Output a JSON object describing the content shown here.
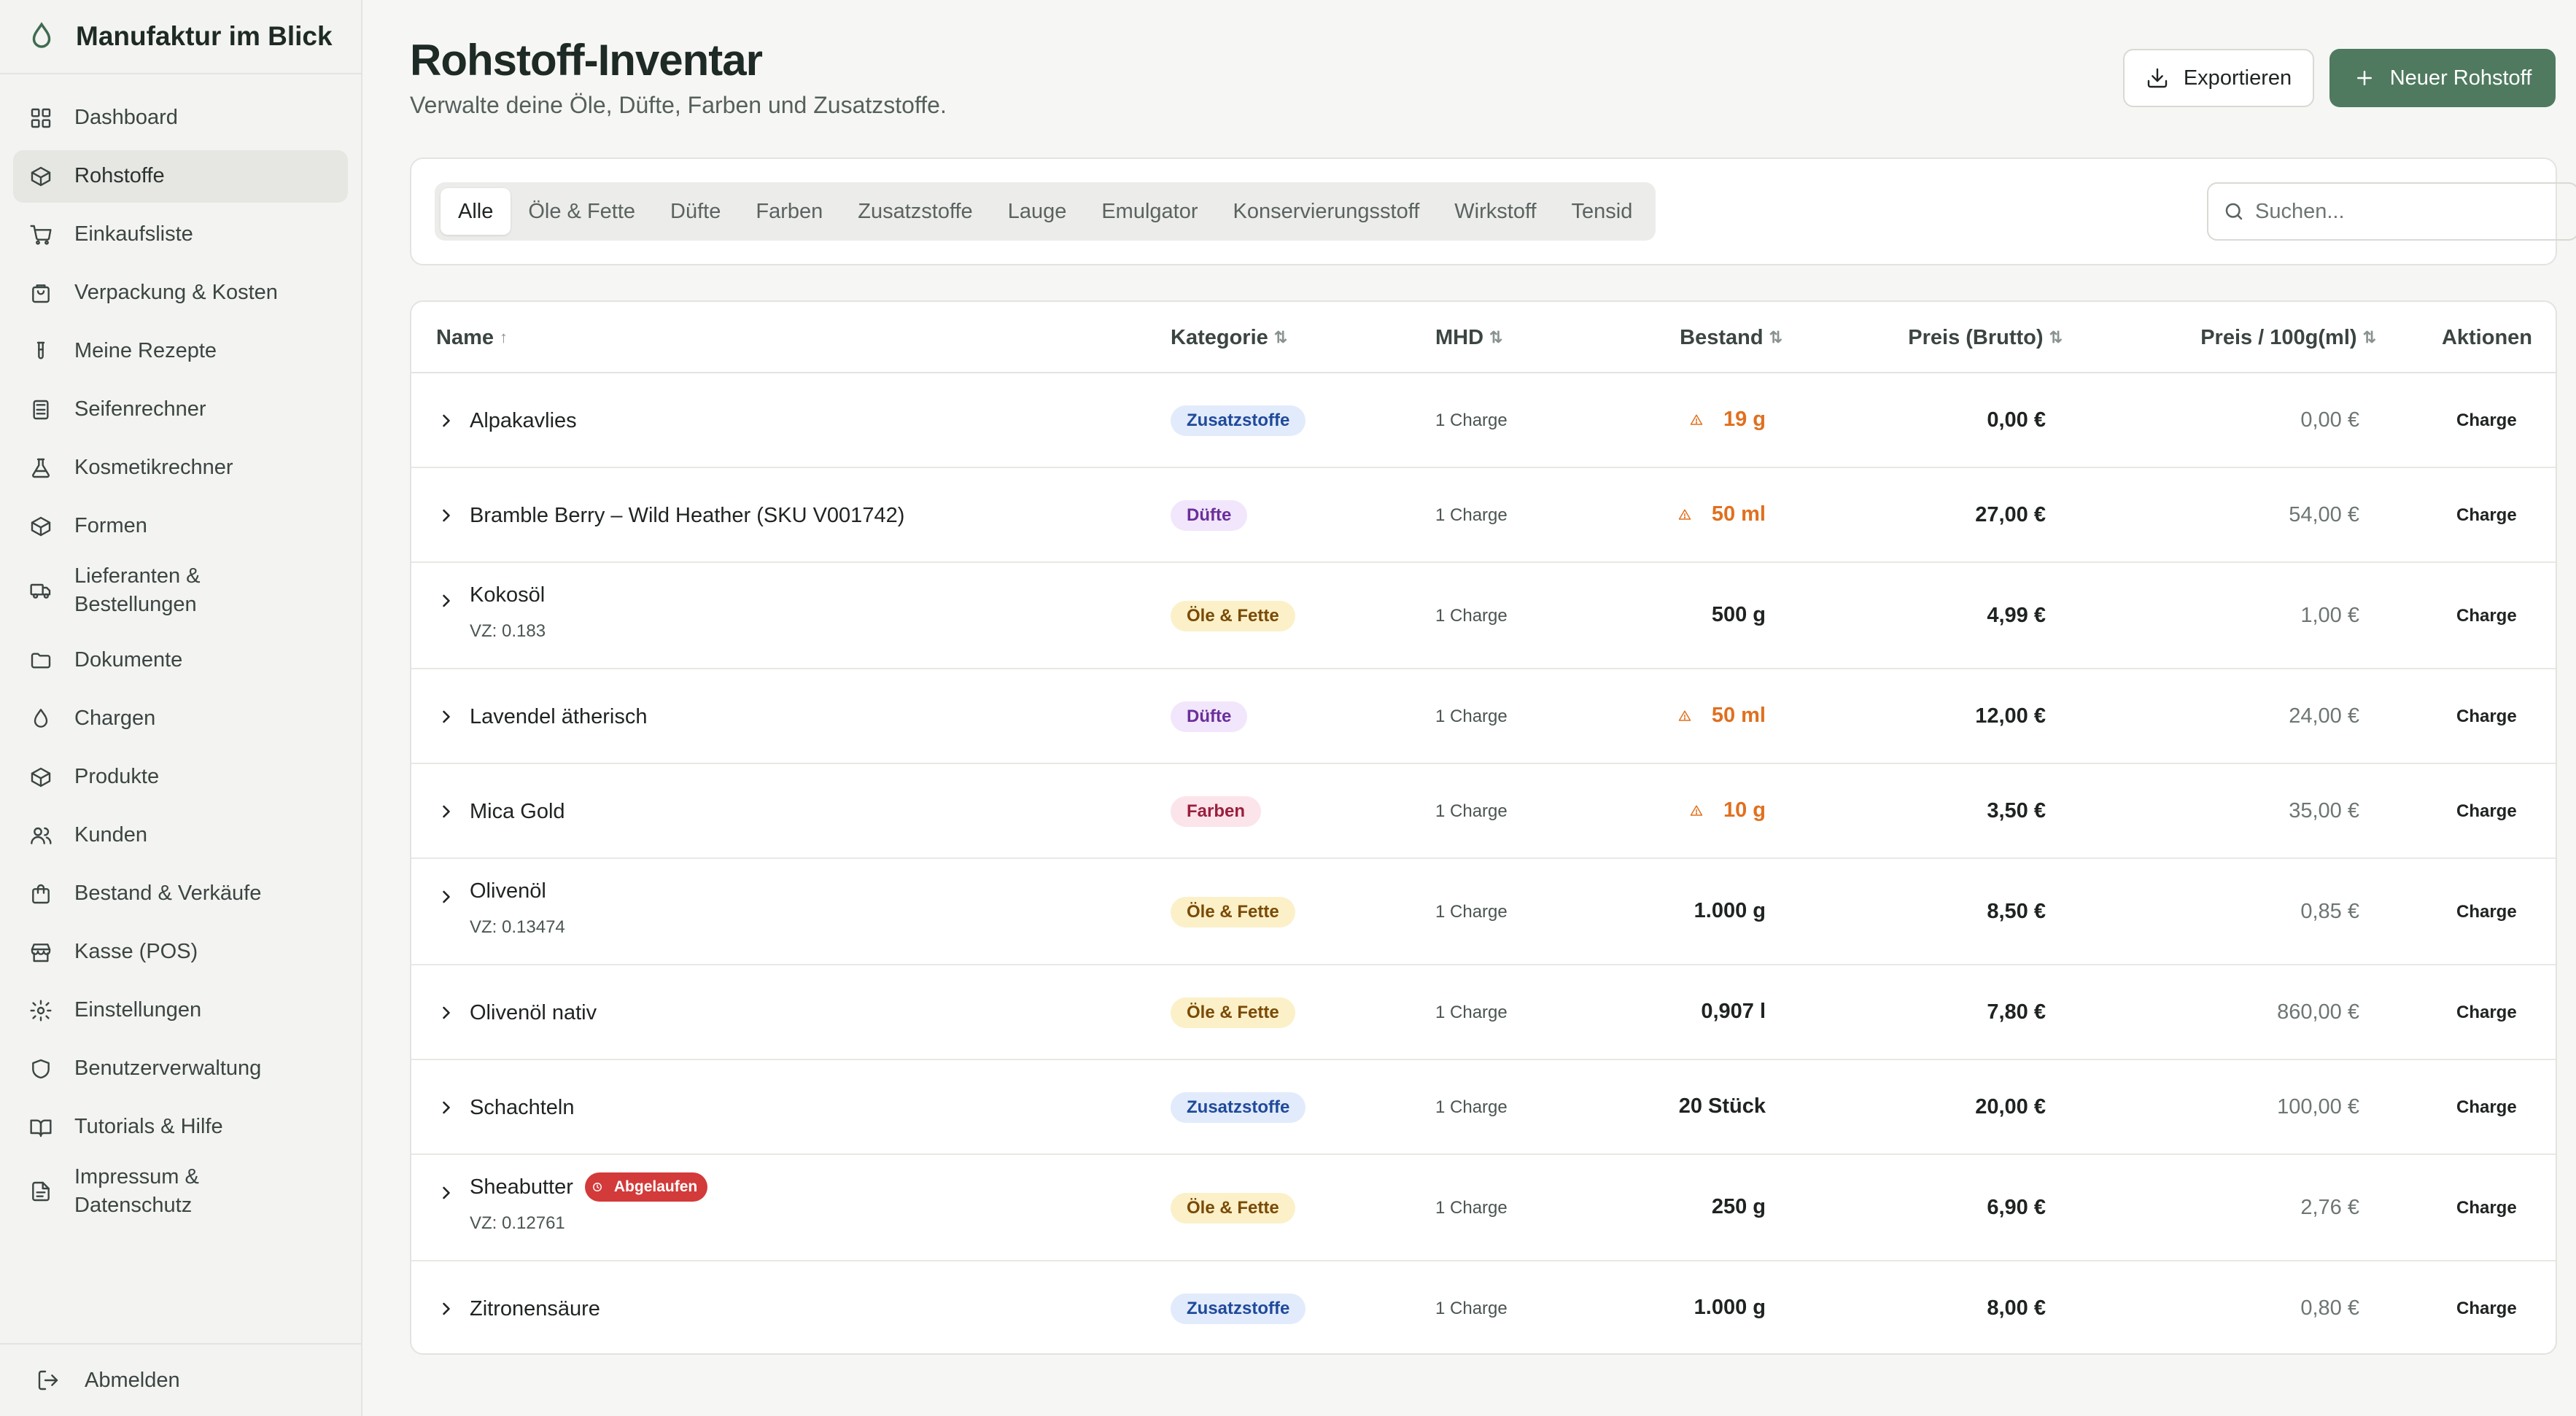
{
  "app": {
    "title": "Manufaktur im Blick"
  },
  "sidebar": {
    "items": [
      {
        "label": "Dashboard",
        "icon": "grid-icon",
        "active": false
      },
      {
        "label": "Rohstoffe",
        "icon": "package-icon",
        "active": true
      },
      {
        "label": "Einkaufsliste",
        "icon": "cart-icon",
        "active": false
      },
      {
        "label": "Verpackung & Kosten",
        "icon": "bag-icon",
        "active": false
      },
      {
        "label": "Meine Rezepte",
        "icon": "test-tube-icon",
        "active": false
      },
      {
        "label": "Seifenrechner",
        "icon": "calculator-icon",
        "active": false
      },
      {
        "label": "Kosmetikrechner",
        "icon": "flask-icon",
        "active": false
      },
      {
        "label": "Formen",
        "icon": "box-icon",
        "active": false
      },
      {
        "label": "Lieferanten & Bestellungen",
        "icon": "truck-icon",
        "active": false
      },
      {
        "label": "Dokumente",
        "icon": "folder-icon",
        "active": false
      },
      {
        "label": "Chargen",
        "icon": "droplet-icon",
        "active": false
      },
      {
        "label": "Produkte",
        "icon": "package-icon",
        "active": false
      },
      {
        "label": "Kunden",
        "icon": "users-icon",
        "active": false
      },
      {
        "label": "Bestand & Verkäufe",
        "icon": "shopping-bag-icon",
        "active": false
      },
      {
        "label": "Kasse (POS)",
        "icon": "store-icon",
        "active": false
      },
      {
        "label": "Einstellungen",
        "icon": "gear-icon",
        "active": false
      },
      {
        "label": "Benutzerverwaltung",
        "icon": "shield-icon",
        "active": false
      },
      {
        "label": "Tutorials & Hilfe",
        "icon": "book-icon",
        "active": false
      },
      {
        "label": "Impressum & Datenschutz",
        "icon": "document-icon",
        "active": false
      }
    ],
    "logout": "Abmelden"
  },
  "header": {
    "title": "Rohstoff-Inventar",
    "subtitle": "Verwalte deine Öle, Düfte, Farben und Zusatzstoffe.",
    "export_label": "Exportieren",
    "new_label": "Neuer Rohstoff"
  },
  "filters": {
    "tabs": [
      "Alle",
      "Öle & Fette",
      "Düfte",
      "Farben",
      "Zusatzstoffe",
      "Lauge",
      "Emulgator",
      "Konservierungsstoff",
      "Wirkstoff",
      "Tensid"
    ],
    "active_tab": "Alle",
    "search_placeholder": "Suchen..."
  },
  "table": {
    "columns": {
      "name": "Name",
      "category": "Kategorie",
      "mhd": "MHD",
      "stock": "Bestand",
      "price": "Preis (Brutto)",
      "price100": "Preis / 100g(ml)",
      "actions": "Aktionen"
    },
    "sort_asc": "↑",
    "sort_both": "⇅",
    "action_label": "Charge",
    "rows": [
      {
        "name": "Alpakavlies",
        "sub": "",
        "expired": "",
        "category": "Zusatzstoffe",
        "mhd": "1 Charge",
        "stock": "19 g",
        "low": true,
        "price": "0,00 €",
        "price100": "0,00 €"
      },
      {
        "name": "Bramble Berry – Wild Heather (SKU V001742)",
        "sub": "",
        "expired": "",
        "category": "Düfte",
        "mhd": "1 Charge",
        "stock": "50 ml",
        "low": true,
        "price": "27,00 €",
        "price100": "54,00 €"
      },
      {
        "name": "Kokosöl",
        "sub": "VZ: 0.183",
        "expired": "",
        "category": "Öle & Fette",
        "mhd": "1 Charge",
        "stock": "500 g",
        "low": false,
        "price": "4,99 €",
        "price100": "1,00 €"
      },
      {
        "name": "Lavendel ätherisch",
        "sub": "",
        "expired": "",
        "category": "Düfte",
        "mhd": "1 Charge",
        "stock": "50 ml",
        "low": true,
        "price": "12,00 €",
        "price100": "24,00 €"
      },
      {
        "name": "Mica Gold",
        "sub": "",
        "expired": "",
        "category": "Farben",
        "mhd": "1 Charge",
        "stock": "10 g",
        "low": true,
        "price": "3,50 €",
        "price100": "35,00 €"
      },
      {
        "name": "Olivenöl",
        "sub": "VZ: 0.13474",
        "expired": "",
        "category": "Öle & Fette",
        "mhd": "1 Charge",
        "stock": "1.000 g",
        "low": false,
        "price": "8,50 €",
        "price100": "0,85 €"
      },
      {
        "name": "Olivenöl nativ",
        "sub": "",
        "expired": "",
        "category": "Öle & Fette",
        "mhd": "1 Charge",
        "stock": "0,907 l",
        "low": false,
        "price": "7,80 €",
        "price100": "860,00 €"
      },
      {
        "name": "Schachteln",
        "sub": "",
        "expired": "",
        "category": "Zusatzstoffe",
        "mhd": "1 Charge",
        "stock": "20 Stück",
        "low": false,
        "price": "20,00 €",
        "price100": "100,00 €"
      },
      {
        "name": "Sheabutter",
        "sub": "VZ: 0.12761",
        "expired": "Abgelaufen",
        "category": "Öle & Fette",
        "mhd": "1 Charge",
        "stock": "250 g",
        "low": false,
        "price": "6,90 €",
        "price100": "2,76 €"
      },
      {
        "name": "Zitronensäure",
        "sub": "",
        "expired": "",
        "category": "Zusatzstoffe",
        "mhd": "1 Charge",
        "stock": "1.000 g",
        "low": false,
        "price": "8,00 €",
        "price100": "0,80 €"
      }
    ]
  },
  "colors": {
    "accent": "#4f7a5f",
    "warning": "#e0701f",
    "danger": "#d33a3a",
    "badge_oele_bg": "#fbf0c8",
    "badge_oele_fg": "#7a4a06",
    "badge_duefte_bg": "#f1e6fb",
    "badge_duefte_fg": "#6b2f9a",
    "badge_farben_bg": "#fbe4ea",
    "badge_farben_fg": "#9a1f3d",
    "badge_zusatz_bg": "#e2ebfb",
    "badge_zusatz_fg": "#1f4a9a"
  }
}
